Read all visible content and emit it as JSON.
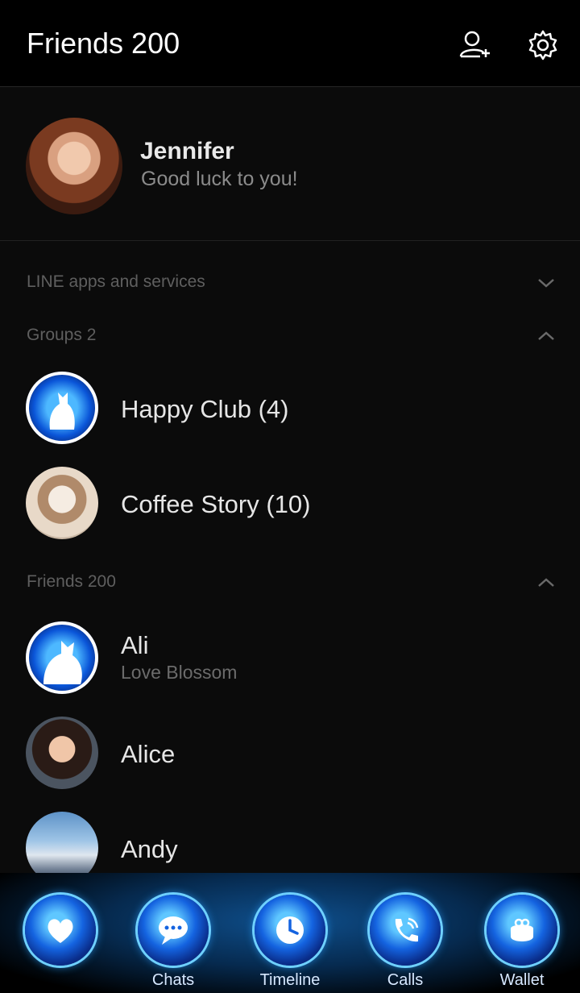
{
  "header": {
    "title": "Friends 200",
    "add_friend_icon": "add-friend-icon",
    "settings_icon": "gear-icon"
  },
  "profile": {
    "name": "Jennifer",
    "status": "Good luck to you!"
  },
  "sections": {
    "line_apps": "LINE apps and services",
    "groups": "Groups 2",
    "friends": "Friends 200"
  },
  "groups": [
    {
      "name": "Happy Club (4)"
    },
    {
      "name": "Coffee Story (10)"
    }
  ],
  "friends": [
    {
      "name": "Ali",
      "status": "Love Blossom"
    },
    {
      "name": "Alice"
    },
    {
      "name": "Andy"
    }
  ],
  "tabs": [
    {
      "label": "",
      "icon": "heart-icon"
    },
    {
      "label": "Chats",
      "icon": "chat-bubble-icon"
    },
    {
      "label": "Timeline",
      "icon": "clock-icon"
    },
    {
      "label": "Calls",
      "icon": "phone-icon"
    },
    {
      "label": "Wallet",
      "icon": "purse-icon"
    }
  ],
  "colors": {
    "background": "#0b0b0b",
    "header_bg": "#000000",
    "accent_blue": "#1463e0"
  }
}
